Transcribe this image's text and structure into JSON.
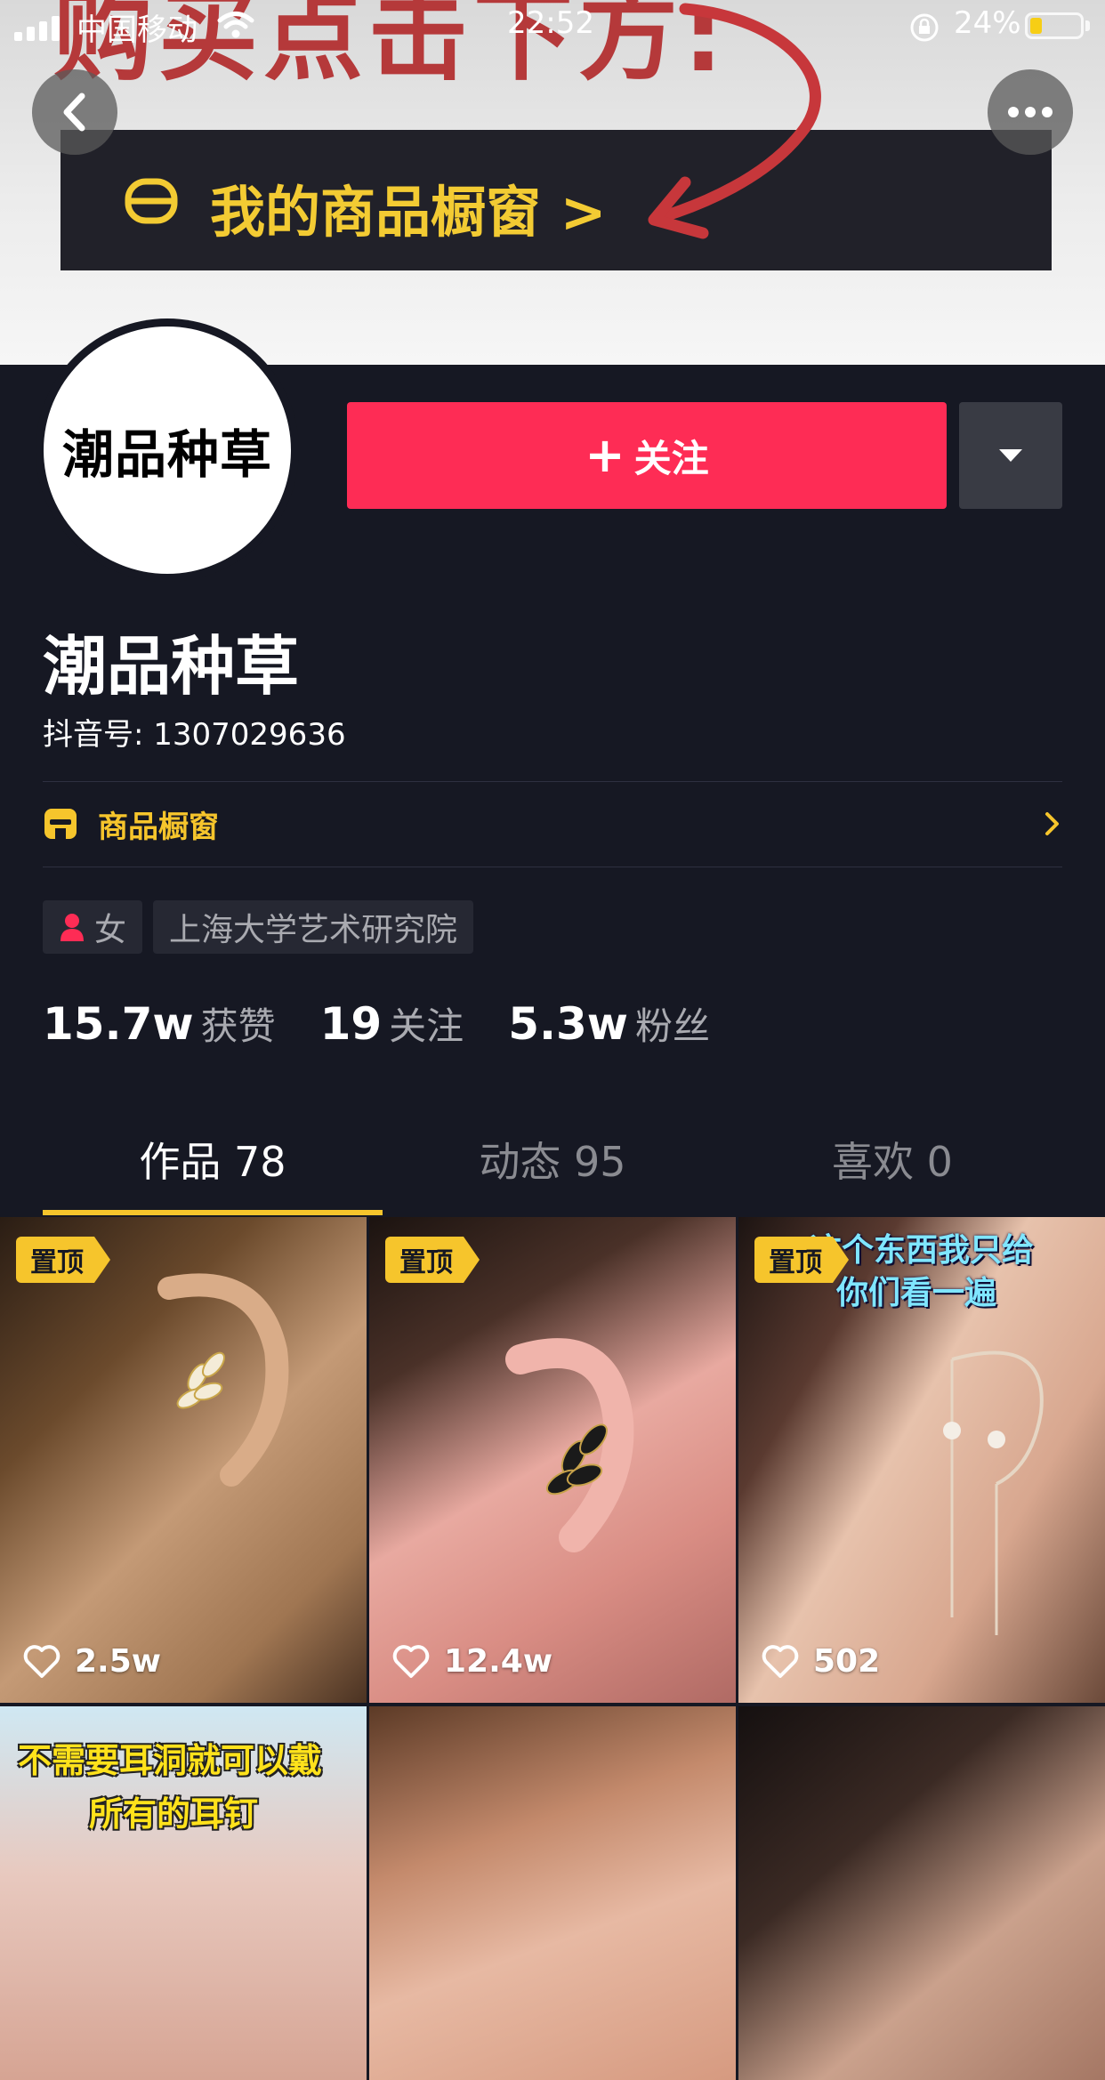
{
  "status_bar": {
    "carrier": "中国移动",
    "time": "22:52",
    "battery_percent": "24%",
    "battery_level": 0.24
  },
  "banner": {
    "big_text": "购买点击下方:",
    "store_text": "我的商品橱窗 >"
  },
  "avatar_text": "潮品种草",
  "actions": {
    "follow_plus": "+",
    "follow_label": "关注"
  },
  "profile": {
    "name": "潮品种草",
    "douyin_id": "抖音号: 1307029636",
    "shop_label": "商品橱窗",
    "tags": {
      "gender": "女",
      "school": "上海大学艺术研究院"
    },
    "stats": [
      {
        "num": "15.7w",
        "label": "获赞"
      },
      {
        "num": "19",
        "label": "关注"
      },
      {
        "num": "5.3w",
        "label": "粉丝"
      }
    ]
  },
  "tabs": [
    {
      "label": "作品 78"
    },
    {
      "label": "动态 95"
    },
    {
      "label": "喜欢 0"
    }
  ],
  "videos": [
    {
      "pin": "置顶",
      "likes": "2.5w"
    },
    {
      "pin": "置顶",
      "likes": "12.4w"
    },
    {
      "pin": "置顶",
      "likes": "502",
      "caption_line1": "这个东西我只给",
      "caption_line2": "你们看一遍"
    },
    {
      "caption_line1": "不需要耳洞就可以戴",
      "caption_line2": "所有的耳钉"
    },
    {},
    {}
  ],
  "colors": {
    "background": "#161823",
    "follow_button": "#fe2c55",
    "accent_yellow": "#f6c52c"
  },
  "icons": [
    "back-icon",
    "more-icon",
    "dropdown-icon",
    "store-icon",
    "chevron-right-icon",
    "gender-female-icon",
    "heart-icon",
    "wifi-icon",
    "lock-rotation-icon"
  ]
}
